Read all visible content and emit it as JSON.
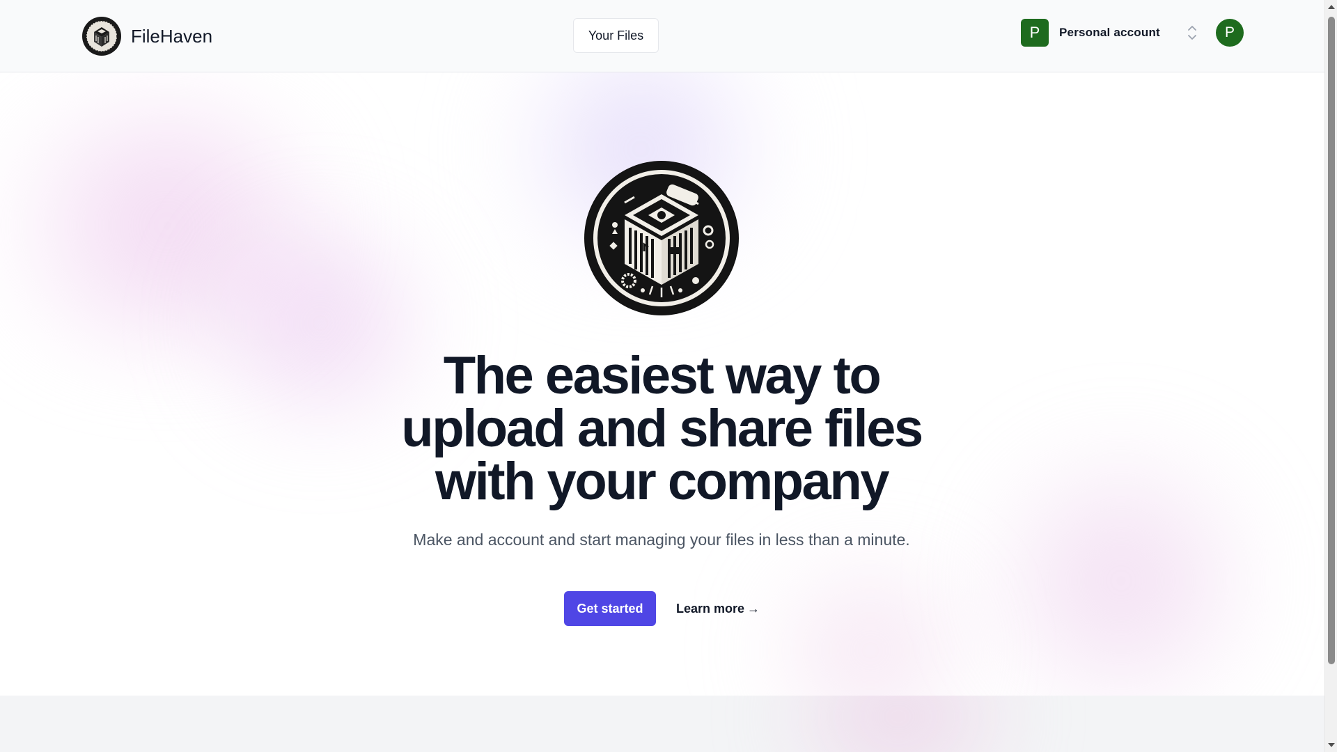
{
  "header": {
    "brand": {
      "name": "FileHaven",
      "logo_icon": "filehaven-logo-icon"
    },
    "nav": {
      "your_files_label": "Your Files"
    },
    "account": {
      "badge_letter": "P",
      "label": "Personal account",
      "chevron_icon": "chevron-up-down-icon",
      "badge_color": "#1e6b1e"
    },
    "user": {
      "avatar_letter": "P",
      "avatar_color": "#1e6b1e"
    }
  },
  "hero": {
    "logo_icon": "filehaven-emblem-icon",
    "title_lines": [
      "The easiest way to",
      "upload and share files",
      "with your company"
    ],
    "subtitle": "Make and account and start managing your files in less than a minute.",
    "primary_cta": "Get started",
    "secondary_cta": "Learn more",
    "secondary_cta_arrow": "→",
    "accent_color": "#4f46e5"
  },
  "scrollbar": {
    "up_icon": "scroll-up-arrow-icon",
    "down_icon": "scroll-down-arrow-icon"
  }
}
